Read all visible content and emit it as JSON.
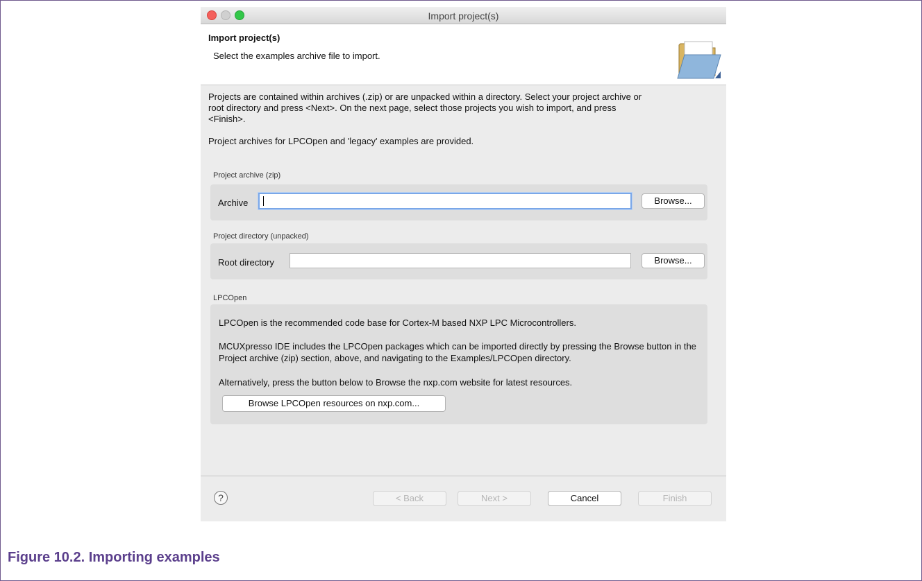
{
  "window": {
    "title": "Import project(s)"
  },
  "banner": {
    "title": "Import project(s)",
    "subtitle": "Select the examples archive file to import."
  },
  "intro": {
    "paragraph1": "Projects are contained within archives (.zip) or are unpacked within a directory. Select your project archive or root directory and press <Next>. On the next page, select those projects you wish to import, and press <Finish>.",
    "paragraph2": "Project archives for LPCOpen and 'legacy' examples are provided."
  },
  "archive_group": {
    "label": "Project archive (zip)",
    "field_label": "Archive",
    "value": "",
    "browse": "Browse..."
  },
  "directory_group": {
    "label": "Project directory (unpacked)",
    "field_label": "Root directory",
    "value": "",
    "browse": "Browse..."
  },
  "lpcopen_group": {
    "label": "LPCOpen",
    "text1": "LPCOpen is the recommended code base for Cortex-M based NXP LPC Microcontrollers.",
    "text2": "MCUXpresso IDE includes the LPCOpen packages which can be imported directly by pressing the Browse button in the Project archive (zip) section, above, and navigating to the Examples/LPCOpen directory.",
    "text3": "Alternatively, press the button below to Browse the nxp.com website for latest resources.",
    "button": "Browse LPCOpen resources on nxp.com..."
  },
  "footer": {
    "help": "?",
    "back": "< Back",
    "next": "Next >",
    "cancel": "Cancel",
    "finish": "Finish"
  },
  "caption": "Figure 10.2. Importing examples",
  "icons": {
    "folder": "folder-icon",
    "help": "help-icon"
  },
  "colors": {
    "caption": "#5b3f8c",
    "frame_border": "#6f5a8d",
    "focus_ring": "#7aa7e8"
  }
}
